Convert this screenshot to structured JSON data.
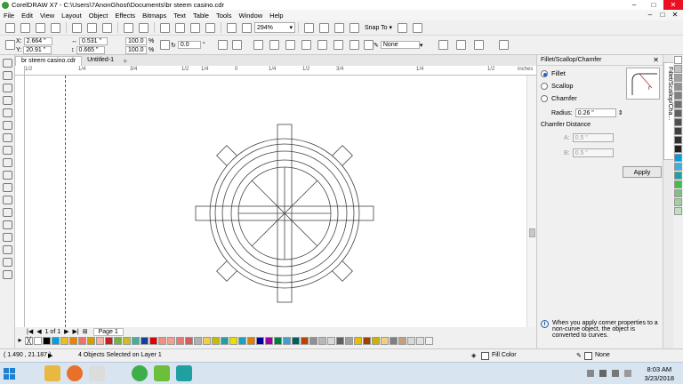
{
  "window": {
    "title": "CorelDRAW X7 - C:\\Users\\7AnonGhost\\Documents\\br steem casino.cdr",
    "controls": [
      "–",
      "□",
      "✕"
    ]
  },
  "menu": [
    "File",
    "Edit",
    "View",
    "Layout",
    "Object",
    "Effects",
    "Bitmaps",
    "Text",
    "Table",
    "Tools",
    "Window",
    "Help"
  ],
  "menu_mdi": [
    "–",
    "□",
    "✕"
  ],
  "standard_toolbar": {
    "zoom": "294%",
    "snap_to": "Snap To"
  },
  "property_bar": {
    "x_label": "X:",
    "x_value": "2.664 \"",
    "y_label": "Y:",
    "y_value": "20.91 \"",
    "w_value": "0.531 \"",
    "h_value": "0.665 \"",
    "scale_w": "100.0",
    "scale_h": "100.0",
    "pct": "%",
    "rotation": "0.0",
    "degree": "°",
    "outline": "None"
  },
  "doc_tabs": {
    "tabs": [
      "br steem casino.cdr",
      "Untitled-1"
    ],
    "plus": "+"
  },
  "ruler": {
    "units": "inches",
    "h_labels": [
      "1/2",
      "1/4",
      "3/4",
      "1/2",
      "1/4",
      "0",
      "1/4",
      "1/2",
      "3/4",
      "1/4",
      "1/2"
    ]
  },
  "page_nav": {
    "count": "1 of 1",
    "page_tab": "Page 1"
  },
  "palette": [
    "#ffffff",
    "#000000",
    "#00a0e0",
    "#e8c020",
    "#f08000",
    "#f07070",
    "#d0a000",
    "#f8b0a0",
    "#c02020",
    "#7ab040",
    "#c8c020",
    "#40b0a0",
    "#1040a0",
    "#e00000",
    "#f09080",
    "#f0a090",
    "#e87870",
    "#d06060",
    "#b0b0b0",
    "#f0d040",
    "#c0c000",
    "#20a0a0",
    "#e8e000",
    "#20a0c0",
    "#e08000",
    "#0000a0",
    "#a000a0",
    "#008040",
    "#40a0d0",
    "#006060",
    "#c04000",
    "#909090",
    "#b8b8b8",
    "#d8d8d8",
    "#606060",
    "#a0a0a0",
    "#e8c000",
    "#a04000",
    "#d0b000",
    "#f0d080",
    "#808080",
    "#c0a080",
    "#d8d8d8",
    "#e0e0e0",
    "#f0f0f0"
  ],
  "right_palette": [
    "#ffffff",
    "#c0c0c0",
    "#a0a0a0",
    "#909090",
    "#808080",
    "#707070",
    "#606060",
    "#505050",
    "#404040",
    "#303030",
    "#202020",
    "#00a0e0",
    "#40b0e0",
    "#20a0a0",
    "#40c040",
    "#80c080",
    "#a0d0a0",
    "#c0e0c0"
  ],
  "docker": {
    "title": "Fillet/Scallop/Chamfer",
    "close": "✕",
    "options": [
      "Fillet",
      "Scallop",
      "Chamfer"
    ],
    "selected": "Fillet",
    "radius_label": "Radius:",
    "radius_value": "0.26 \"",
    "chamfer_heading": "Chamfer Distance",
    "a_label": "A:",
    "a_value": "0.5 \"",
    "b_label": "B:",
    "b_value": "0.5 \"",
    "apply": "Apply",
    "info": "When you apply corner properties to a non-curve object, the object is converted to curves.",
    "side_tab": "Fillet/Scallop/Cha..."
  },
  "status": {
    "coords": "( 1.490 , 21.187 )",
    "selection": "4 Objects Selected on Layer 1",
    "fill": "Fill Color",
    "outline": "None"
  },
  "taskbar": {
    "time": "8:03 AM",
    "date": "3/23/2018",
    "apps": [
      "start-button",
      "explorer",
      "firefox",
      "chrome",
      "coreldraw",
      "store",
      "app-icon"
    ]
  },
  "colors": {
    "accent": "#2060d0",
    "guide": "#4040ff",
    "taskbar": "#d9e4f1"
  }
}
